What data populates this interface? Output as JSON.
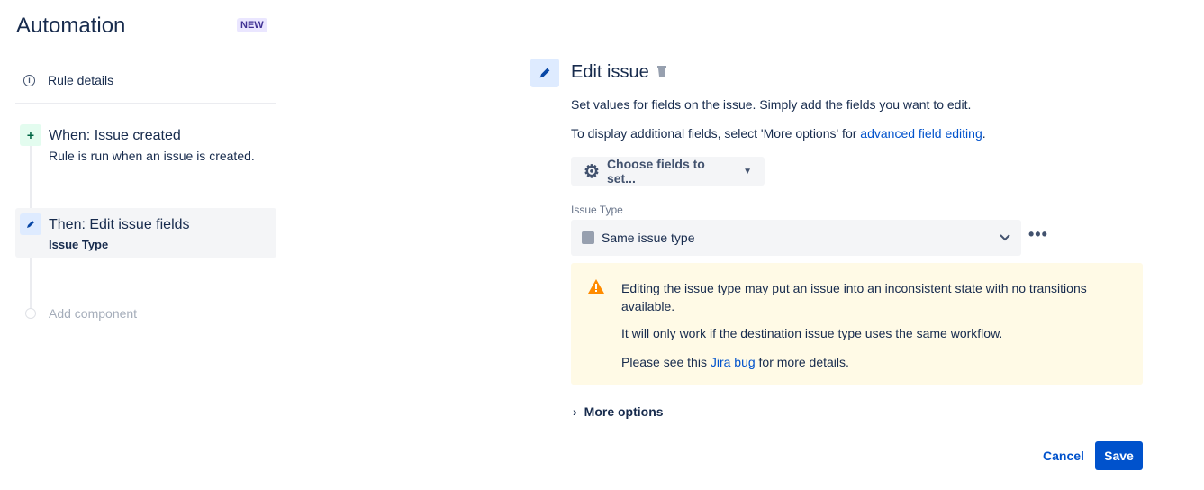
{
  "sidebar": {
    "title": "Automation",
    "badge": "NEW",
    "rule_details": "Rule details",
    "trigger": {
      "title": "When: Issue created",
      "subtitle": "Rule is run when an issue is created."
    },
    "action": {
      "title": "Then: Edit issue fields",
      "subtitle": "Issue Type"
    },
    "add_component": "Add component"
  },
  "main": {
    "title": "Edit issue",
    "desc1": "Set values for fields on the issue. Simply add the fields you want to edit.",
    "desc2_prefix": "To display additional fields, select 'More options' for ",
    "desc2_link": "advanced field editing",
    "desc2_suffix": ".",
    "choose_fields": "Choose fields to set...",
    "field_label": "Issue Type",
    "field_value": "Same issue type",
    "warning": {
      "line1": "Editing the issue type may put an issue into an inconsistent state with no transitions available.",
      "line2": "It will only work if the destination issue type uses the same workflow.",
      "line3_prefix": "Please see this ",
      "line3_link": "Jira bug",
      "line3_suffix": " for more details."
    },
    "more_options": "More options",
    "cancel": "Cancel",
    "save": "Save"
  },
  "colors": {
    "accent": "#0052cc",
    "warning_bg": "#fffae6",
    "warning_icon": "#ff8b00"
  }
}
